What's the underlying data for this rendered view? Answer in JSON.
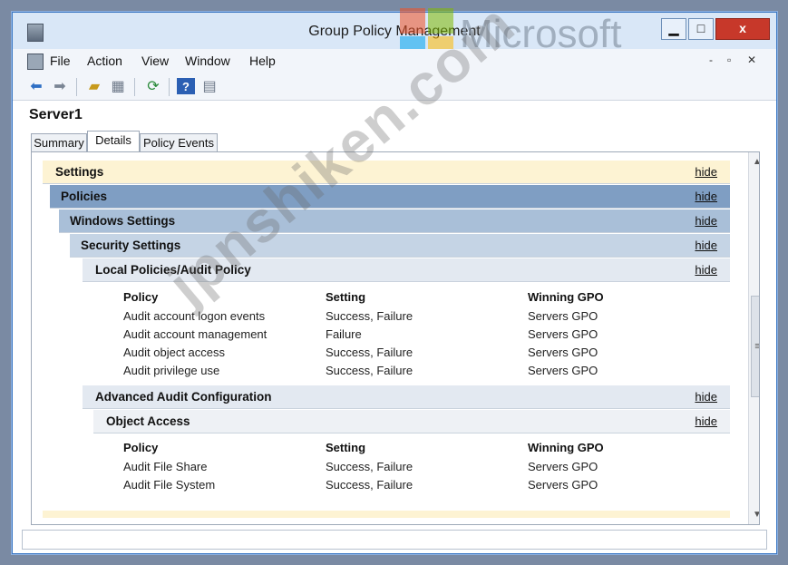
{
  "window": {
    "title": "Group Policy Management",
    "controls": {
      "minimize": "▁",
      "maximize": "□",
      "close": "x"
    }
  },
  "watermarks": {
    "microsoft": "Microsoft",
    "jpnshiken": "jpnshiken.com"
  },
  "menu": {
    "items": [
      "File",
      "Action",
      "View",
      "Window",
      "Help"
    ],
    "mdi": {
      "minimize": "-",
      "restore": "▫",
      "close": "✕"
    }
  },
  "toolbar": {
    "icons": [
      "back-arrow-icon",
      "forward-arrow-icon",
      "folder-up-icon",
      "console-tree-icon",
      "refresh-icon",
      "help-icon",
      "properties-icon"
    ]
  },
  "server": {
    "name": "Server1"
  },
  "tabs": [
    "Summary",
    "Details",
    "Policy Events"
  ],
  "active_tab": "Details",
  "report": {
    "hide_label": "hide",
    "sections": {
      "settings": "Settings",
      "policies": "Policies",
      "windows_settings": "Windows Settings",
      "security_settings": "Security Settings",
      "local_policies": "Local Policies/Audit Policy",
      "advanced_audit": "Advanced Audit Configuration",
      "object_access": "Object Access"
    },
    "columns": {
      "policy": "Policy",
      "setting": "Setting",
      "winning_gpo": "Winning GPO"
    },
    "audit_policy_rows": [
      {
        "policy": "Audit account logon events",
        "setting": "Success, Failure",
        "gpo": "Servers GPO"
      },
      {
        "policy": "Audit account management",
        "setting": "Failure",
        "gpo": "Servers GPO"
      },
      {
        "policy": "Audit object access",
        "setting": "Success, Failure",
        "gpo": "Servers GPO"
      },
      {
        "policy": "Audit privilege use",
        "setting": "Success, Failure",
        "gpo": "Servers GPO"
      }
    ],
    "object_access_rows": [
      {
        "policy": "Audit File Share",
        "setting": "Success, Failure",
        "gpo": "Servers GPO"
      },
      {
        "policy": "Audit File System",
        "setting": "Success, Failure",
        "gpo": "Servers GPO"
      }
    ]
  },
  "colors": {
    "settings_bar": "#fdf3d3",
    "policies_bar": "#7f9ec3",
    "windows_settings_bar": "#a9bfd8",
    "security_settings_bar": "#c5d4e5",
    "subsection_bar": "#e3e9f1"
  }
}
